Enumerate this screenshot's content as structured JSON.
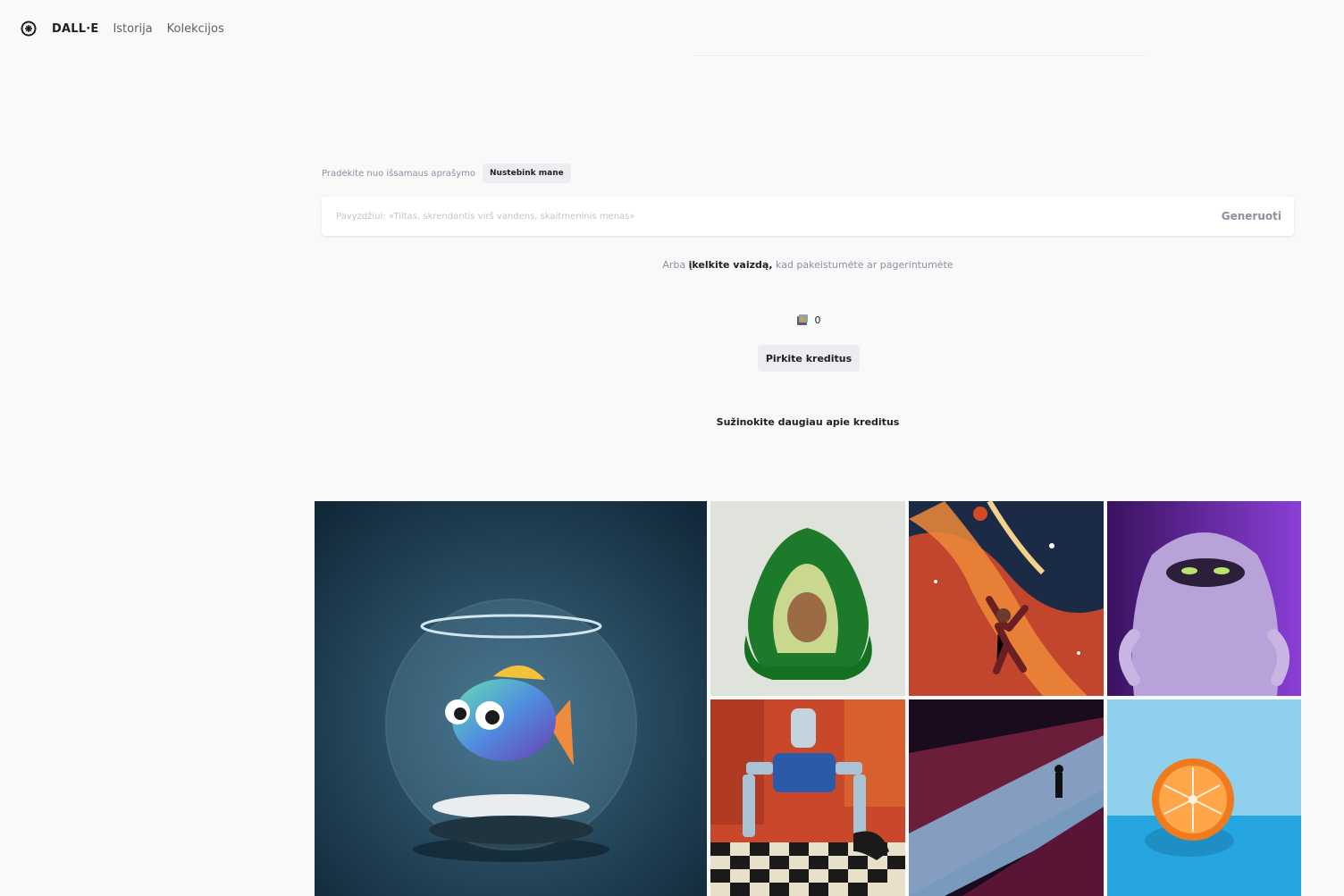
{
  "header": {
    "brand": "DALL·E",
    "nav": [
      "Istorija",
      "Kolekcijos"
    ]
  },
  "prompt": {
    "hint": "Pradėkite nuo išsamaus aprašymo",
    "surprise_label": "Nustebink mane",
    "placeholder": "Pavyzdžiui: «Tiltas, skrendantis virš vandens, skaitmeninis menas»",
    "generate_label": "Generuoti"
  },
  "upload": {
    "prefix": "Arba",
    "link": "įkelkite vaizdą,",
    "suffix": "kad pakeistumėte ar pagerintumėte"
  },
  "credits": {
    "count": "0",
    "buy_label": "Pirkite kreditus",
    "learn_more": "Sužinokite daugiau apie kreditus"
  },
  "colors": {
    "background": "#f9f9fa",
    "text": "#202123",
    "muted": "#8e8ea0",
    "button_bg": "#ececf1"
  }
}
